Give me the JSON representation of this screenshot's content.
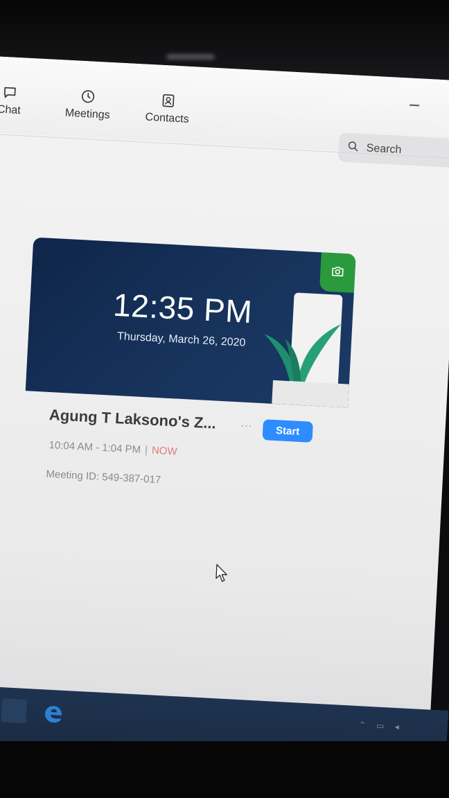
{
  "nav": {
    "tabs": [
      {
        "label": "Chat",
        "icon": "chat-icon"
      },
      {
        "label": "Meetings",
        "icon": "clock-icon"
      },
      {
        "label": "Contacts",
        "icon": "contact-icon"
      }
    ]
  },
  "search": {
    "placeholder": "Search",
    "icon": "search-icon"
  },
  "meeting_card": {
    "clock": "12:35 PM",
    "date": "Thursday, March 26, 2020",
    "camera_icon": "camera-icon",
    "background_color": "#17335c",
    "accent_color": "#2a9a3c"
  },
  "meeting": {
    "title": "Agung T Laksono's Z...",
    "more_label": "···",
    "start_label": "Start",
    "time_range": "10:04 AM - 1:04 PM",
    "separator": "|",
    "status": "NOW",
    "meeting_id": "Meeting ID: 549-387-017",
    "start_color": "#2d8cff",
    "status_color": "#e27b7b"
  },
  "taskbar": {
    "start_icon": "windows-start-icon",
    "browser_icon": "edge-browser-icon",
    "tray_icons": "⌃ ▭ ◂"
  }
}
